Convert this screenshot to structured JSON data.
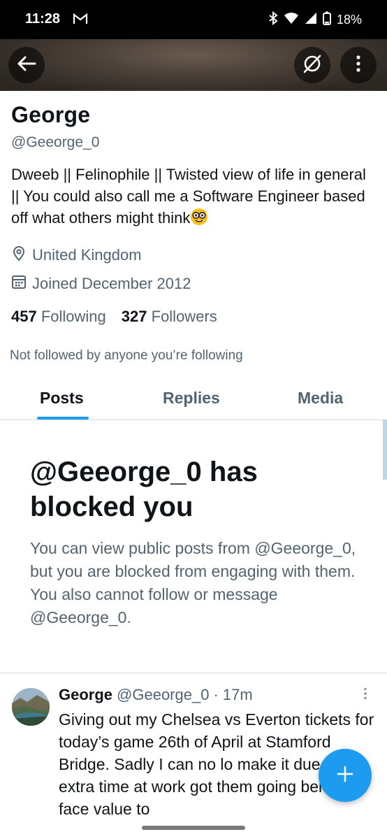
{
  "status_bar": {
    "time": "11:28",
    "battery": "18%",
    "icons": [
      "gmail-icon",
      "bluetooth-icon",
      "wifi-icon",
      "signal-icon",
      "battery-icon"
    ]
  },
  "header": {
    "back_icon": "arrow-left-icon",
    "broken_link_icon": "slash-circle-icon",
    "more_icon": "vertical-ellipsis-icon"
  },
  "profile": {
    "name": "George",
    "handle": "@Geeorge_0",
    "bio": "Dweeb || Felinophile || Twisted view of life in general || You could also call me a Software Engineer based off what others might think",
    "bio_emoji": "nerd-face-emoji",
    "location": "United Kingdom",
    "joined": "Joined December 2012",
    "following_count": "457",
    "following_label": "Following",
    "followers_count": "327",
    "followers_label": "Followers",
    "not_followed_text": "Not followed by anyone you’re following"
  },
  "tabs": [
    {
      "label": "Posts",
      "active": true
    },
    {
      "label": "Replies",
      "active": false
    },
    {
      "label": "Media",
      "active": false
    }
  ],
  "blocked_notice": {
    "title_line1": "@Geeorge_0 has",
    "title_line2": "blocked you",
    "body": "You can view public posts from @Geeorge_0, but you are blocked from engaging with them. You also cannot follow or message @Geeorge_0."
  },
  "post": {
    "name": "George",
    "handle": "@Geeorge_0",
    "time": "· 17m",
    "text": "Giving out my Chelsea vs Everton tickets for today’s game 26th of April at Stamford Bridge. Sadly I can no lo make it due to extra time at work got them going below face value to"
  },
  "fab": {
    "icon": "plus-icon"
  },
  "colors": {
    "accent": "#1d9bf0",
    "text_primary": "#0f1419",
    "text_secondary": "#536471",
    "divider": "#cfd9de"
  }
}
